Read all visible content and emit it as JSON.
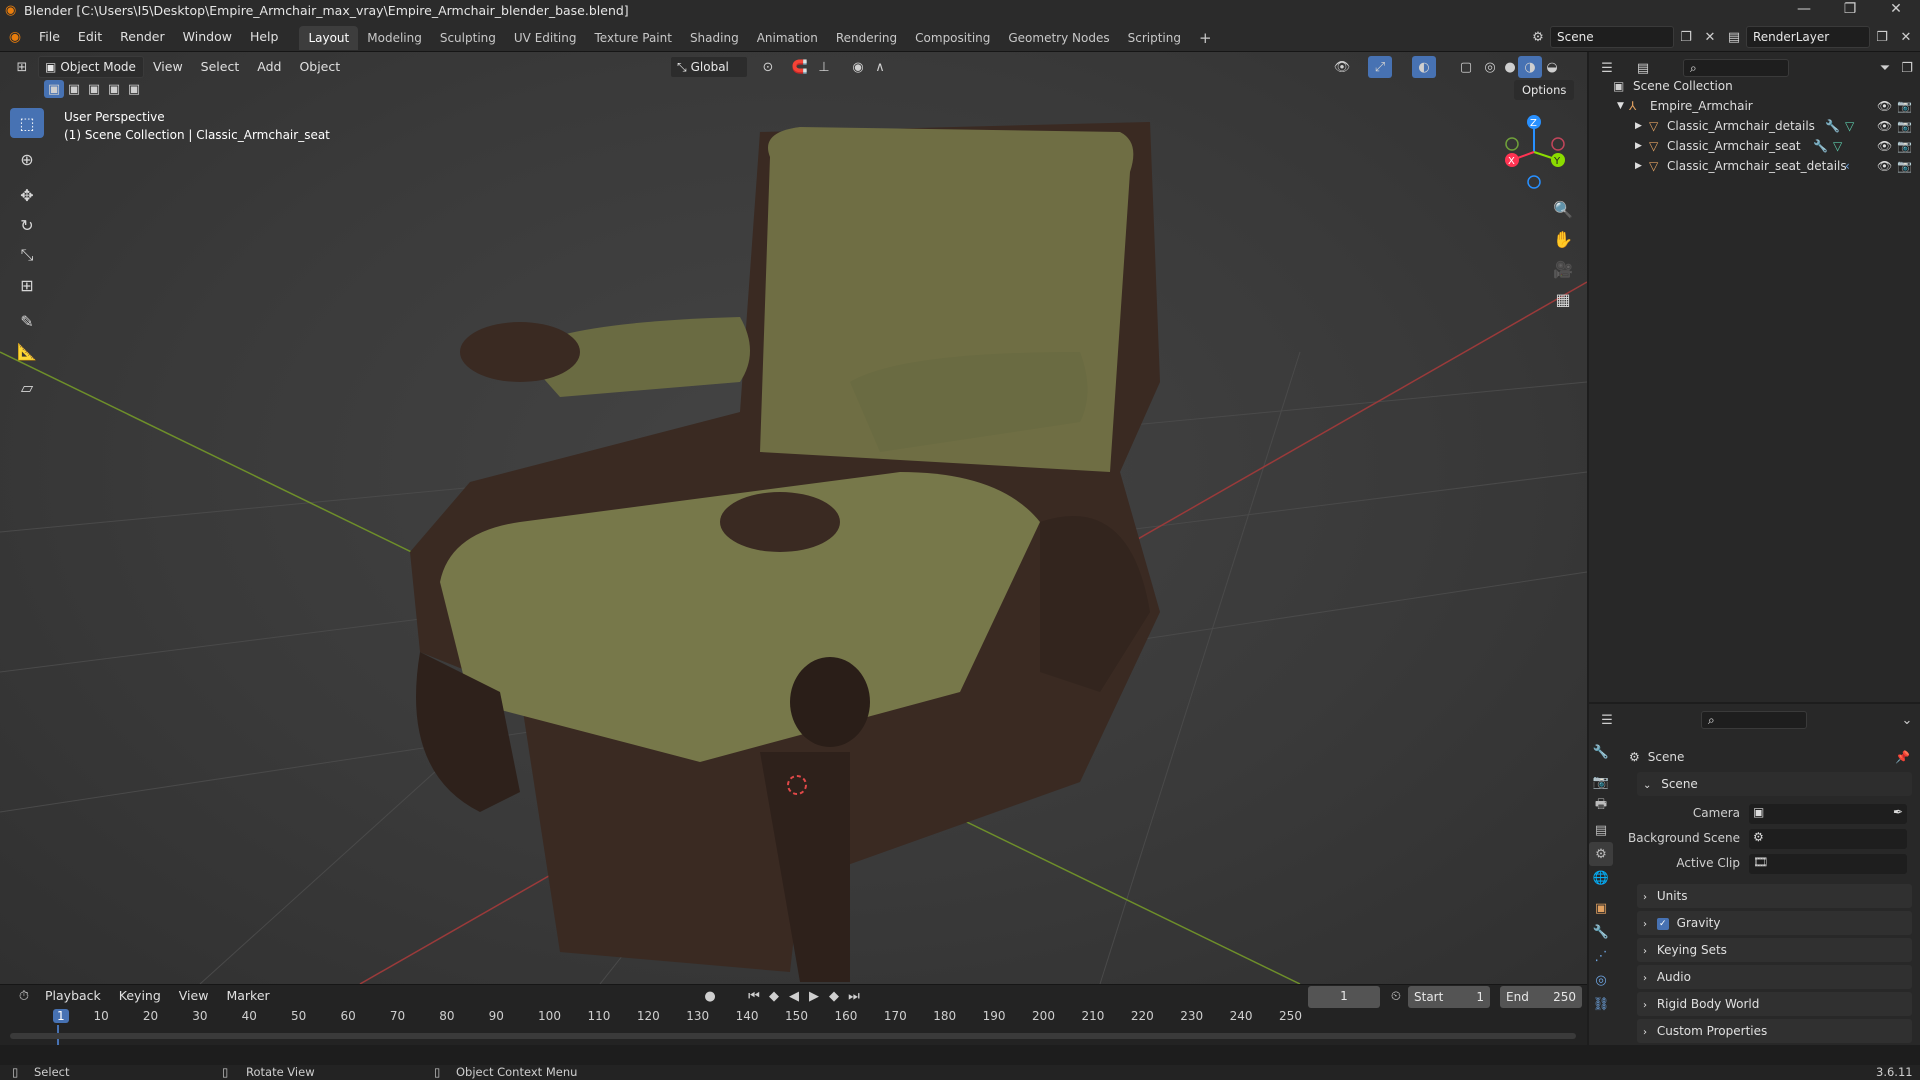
{
  "window": {
    "title": "Blender [C:\\Users\\I5\\Desktop\\Empire_Armchair_max_vray\\Empire_Armchair_blender_base.blend]"
  },
  "menus": [
    "File",
    "Edit",
    "Render",
    "Window",
    "Help"
  ],
  "workspaces": [
    "Layout",
    "Modeling",
    "Sculpting",
    "UV Editing",
    "Texture Paint",
    "Shading",
    "Animation",
    "Rendering",
    "Compositing",
    "Geometry Nodes",
    "Scripting"
  ],
  "active_workspace": "Layout",
  "scene": {
    "name": "Scene",
    "view_layer": "RenderLayer"
  },
  "viewport": {
    "mode": "Object Mode",
    "header_menus": [
      "View",
      "Select",
      "Add",
      "Object"
    ],
    "orientation": "Global",
    "options_label": "Options",
    "overlay_line1": "User Perspective",
    "overlay_line2": "(1) Scene Collection | Classic_Armchair_seat",
    "gizmo_axes": {
      "x": "X",
      "y": "Y",
      "z": "Z"
    }
  },
  "outliner": {
    "root": "Scene Collection",
    "collection": "Empire_Armchair",
    "objects": [
      "Classic_Armchair_details",
      "Classic_Armchair_seat",
      "Classic_Armchair_seat_details"
    ]
  },
  "properties": {
    "header": "Scene",
    "panel_scene": "Scene",
    "camera_label": "Camera",
    "background_scene_label": "Background Scene",
    "active_clip_label": "Active Clip",
    "panels": [
      "Units",
      "Gravity",
      "Keying Sets",
      "Audio",
      "Rigid Body World",
      "Custom Properties"
    ],
    "gravity_checked": true
  },
  "timeline": {
    "menus": [
      "Playback",
      "Keying",
      "View",
      "Marker"
    ],
    "current_frame": "1",
    "start_label": "Start",
    "start": "1",
    "end_label": "End",
    "end": "250",
    "ticks": [
      "1",
      "10",
      "20",
      "30",
      "40",
      "50",
      "60",
      "70",
      "80",
      "90",
      "100",
      "110",
      "120",
      "130",
      "140",
      "150",
      "160",
      "170",
      "180",
      "190",
      "200",
      "210",
      "220",
      "230",
      "240",
      "250"
    ]
  },
  "statusbar": {
    "select": "Select",
    "rotate": "Rotate View",
    "context": "Object Context Menu",
    "version": "3.6.11"
  },
  "colors": {
    "accent": "#4772b3",
    "x_axis": "#ff3352",
    "y_axis": "#8bdc00",
    "z_axis": "#2890ff"
  }
}
